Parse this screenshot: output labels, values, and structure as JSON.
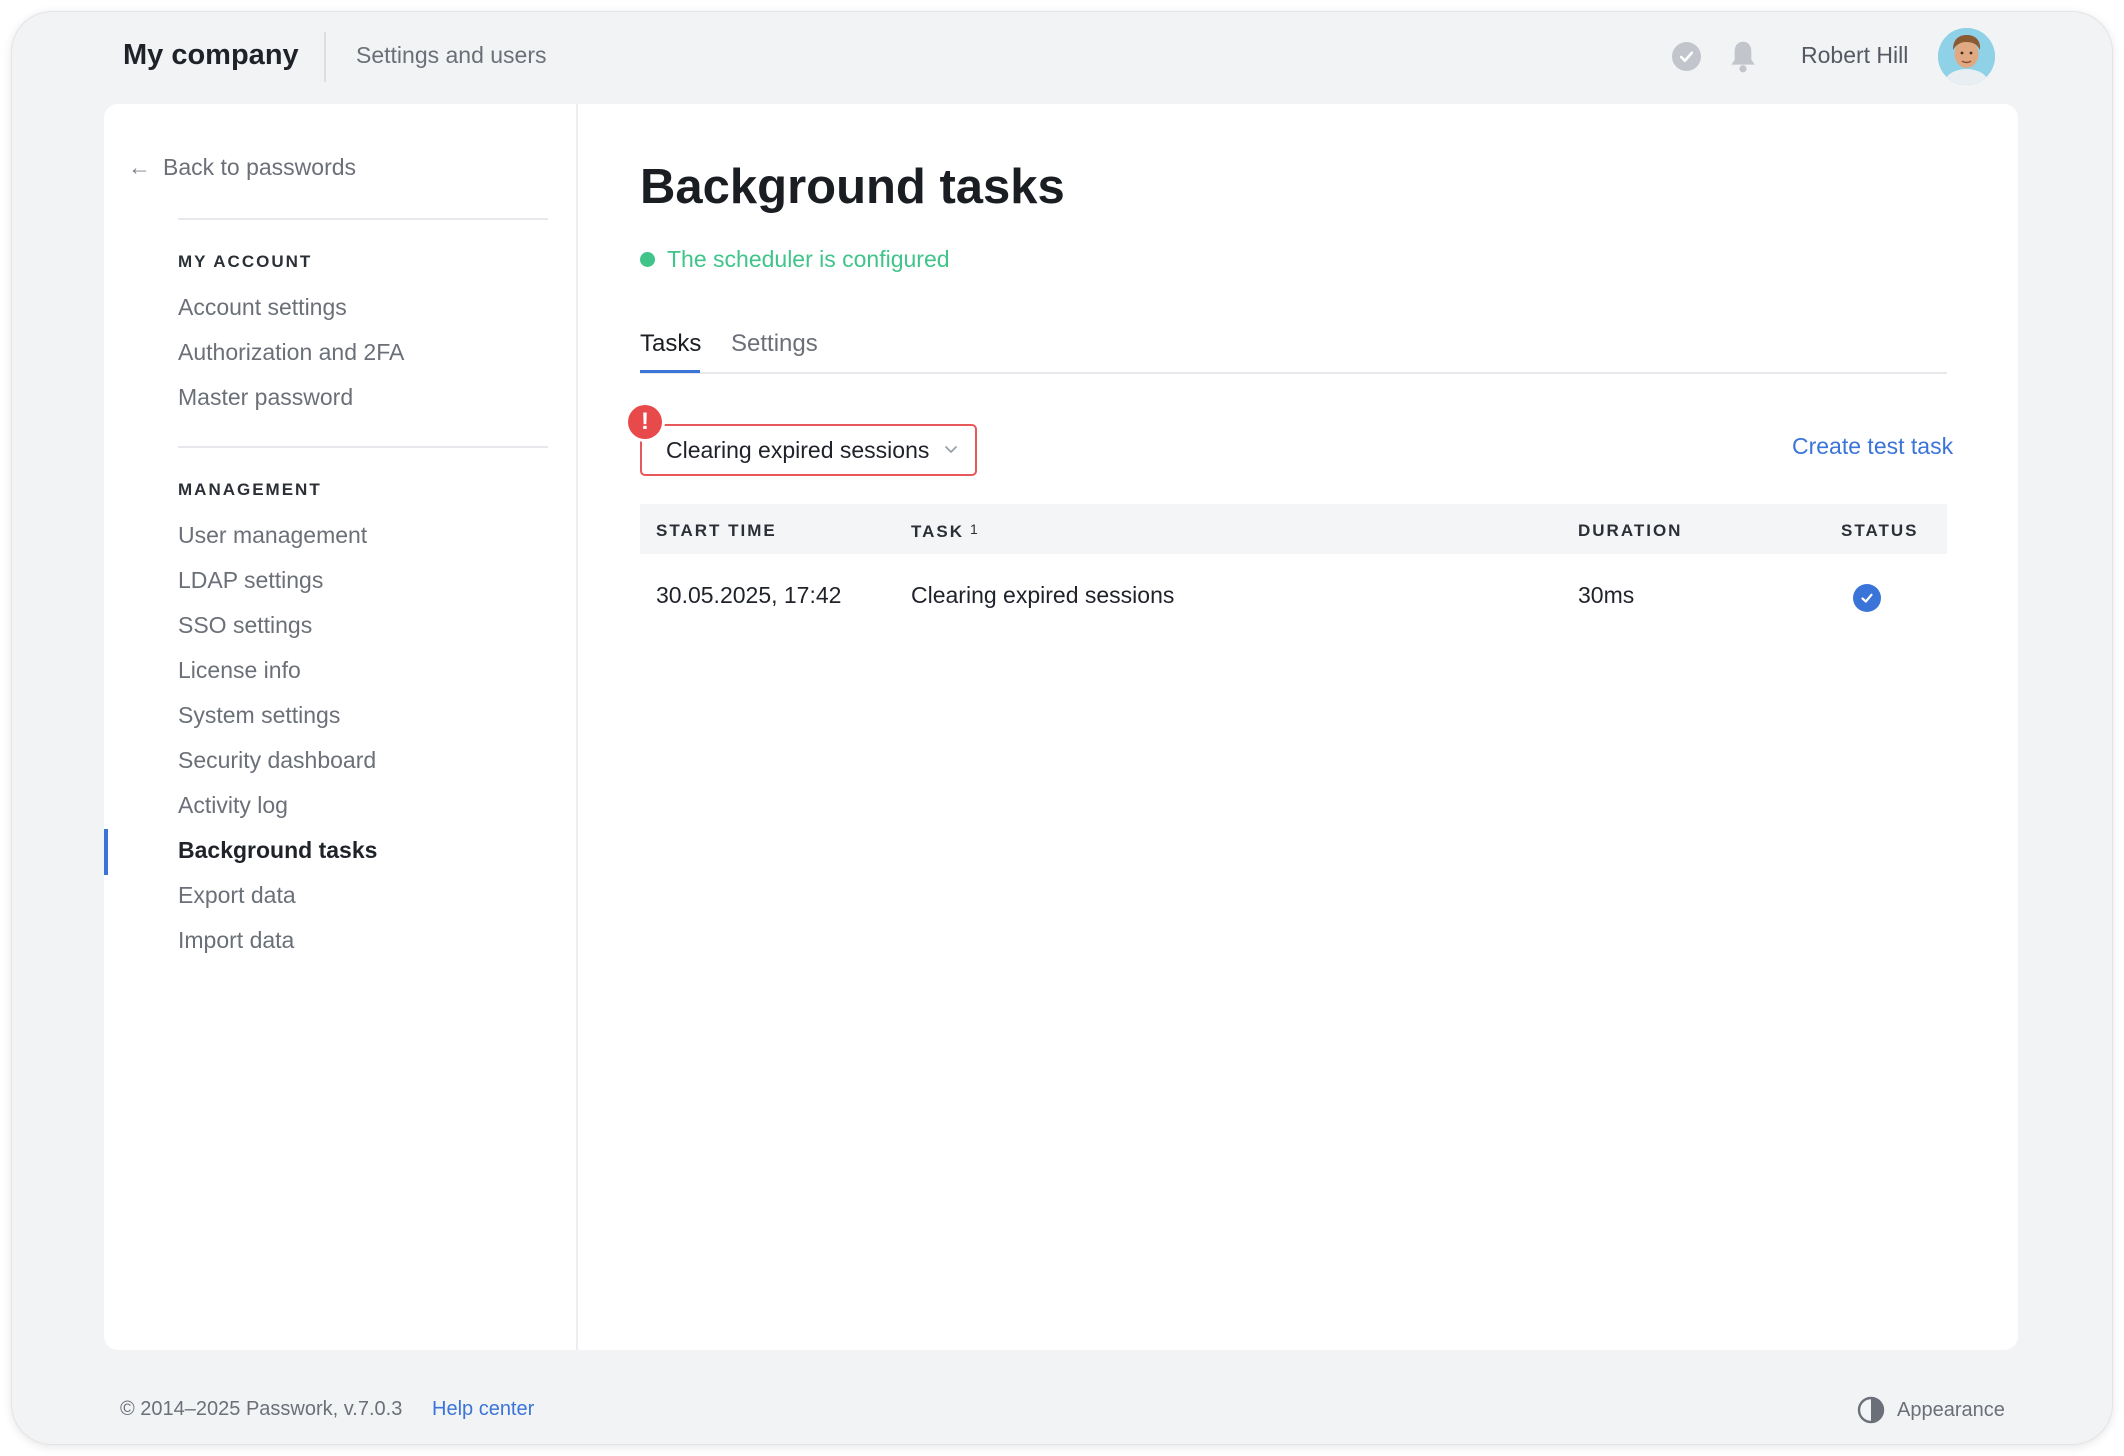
{
  "header": {
    "brand": "My company",
    "breadcrumb": "Settings and users",
    "user_name": "Robert Hill"
  },
  "sidebar": {
    "back_label": "Back to passwords",
    "sections": [
      {
        "heading": "MY ACCOUNT",
        "items": [
          "Account settings",
          "Authorization and 2FA",
          "Master password"
        ]
      },
      {
        "heading": "MANAGEMENT",
        "items": [
          "User management",
          "LDAP settings",
          "SSO settings",
          "License info",
          "System settings",
          "Security dashboard",
          "Activity log",
          "Background tasks",
          "Export data",
          "Import data"
        ]
      }
    ],
    "active_item": "Background tasks"
  },
  "main": {
    "title": "Background tasks",
    "scheduler_status": "The scheduler is configured",
    "tabs": [
      {
        "label": "Tasks",
        "active": true
      },
      {
        "label": "Settings",
        "active": false
      }
    ],
    "filter": {
      "selected": "Clearing expired sessions",
      "alert_glyph": "!"
    },
    "create_link": "Create test task",
    "table": {
      "columns": [
        "START TIME",
        "TASK",
        "DURATION",
        "STATUS"
      ],
      "task_sort_indicator": "1",
      "rows": [
        {
          "start_time": "30.05.2025, 17:42",
          "task": "Clearing expired sessions",
          "duration": "30ms",
          "status": "success"
        }
      ]
    }
  },
  "footer": {
    "copyright": "© 2014–2025 Passwork, v.7.0.3",
    "help": "Help center",
    "appearance": "Appearance"
  },
  "colors": {
    "accent": "#3b74d8",
    "success": "#40c48a",
    "error": "#e8494b"
  },
  "icons": [
    "check-circle-icon",
    "bell-icon",
    "avatar",
    "arrow-left-icon",
    "chevron-down-icon",
    "alert-icon",
    "status-success-icon",
    "contrast-icon"
  ]
}
